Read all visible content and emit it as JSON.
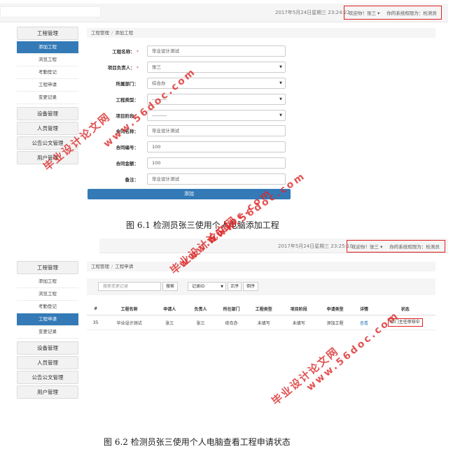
{
  "screen1": {
    "datetime": "2017年5月24日星期三 23:24:22",
    "welcome": "欢迎你！张三",
    "role": "你的系统权限为：检测员",
    "breadcrumb": [
      "工程管理",
      "添加工程"
    ],
    "sidebar": [
      {
        "label": "工程管理",
        "items": [
          "添加工程",
          "浏览工程",
          "考勤登记",
          "工程申请",
          "变更记录"
        ],
        "active": 0
      },
      {
        "label": "设备管理"
      },
      {
        "label": "人员管理"
      },
      {
        "label": "公告公文管理"
      },
      {
        "label": "用户管理"
      }
    ],
    "form": [
      {
        "label": "工程名称",
        "required": true,
        "value": "毕业设计测试",
        "select": false
      },
      {
        "label": "项目负责人",
        "required": true,
        "value": "张三",
        "select": true
      },
      {
        "label": "所属部门",
        "required": false,
        "value": "综合办",
        "select": true
      },
      {
        "label": "工程类型",
        "required": false,
        "value": "---------",
        "select": true
      },
      {
        "label": "项目阶段",
        "required": false,
        "value": "---------",
        "select": true
      },
      {
        "label": "合同名称",
        "required": false,
        "value": "毕业设计测试",
        "select": false
      },
      {
        "label": "合同编号",
        "required": false,
        "value": "100",
        "select": false
      },
      {
        "label": "合同金额",
        "required": false,
        "value": "100",
        "select": false
      },
      {
        "label": "备注",
        "required": false,
        "value": "毕业设计测试",
        "select": false
      }
    ],
    "add_button": "添加",
    "caption": "图 6.1  检测员张三使用个人电脑添加工程"
  },
  "screen2": {
    "datetime": "2017年5月24日星期三 23:25:10",
    "welcome": "欢迎你！张三",
    "role": "你的系统权限为：检测员",
    "breadcrumb": [
      "工程管理",
      "工程申请"
    ],
    "sidebar": [
      {
        "label": "工程管理",
        "items": [
          "添加工程",
          "浏览工程",
          "考勤登记",
          "工程申请",
          "变更记录"
        ],
        "active": 3
      },
      {
        "label": "设备管理"
      },
      {
        "label": "人员管理"
      },
      {
        "label": "公告公文管理"
      },
      {
        "label": "用户管理"
      }
    ],
    "search_placeholder": "搜索变更记录",
    "search_button": "搜索",
    "sort_select": "记录ID",
    "asc_button": "正序",
    "desc_button": "倒序",
    "table": {
      "headers": [
        "#",
        "工程名称",
        "申请人",
        "负责人",
        "所在部门",
        "工程类型",
        "项目阶段",
        "申请类型",
        "详情",
        "状态"
      ],
      "rows": [
        [
          "35",
          "毕业设计测试",
          "张三",
          "张三",
          "综合办",
          "未填写",
          "未填写",
          "添加工程",
          "查看",
          "部门主任审核中"
        ]
      ]
    },
    "caption": "图 6.2  检测员张三使用个人电脑查看工程申请状态"
  },
  "watermarks": {
    "site": "毕业设计论文网",
    "url": "www.56doc.com"
  },
  "colors": {
    "primary": "#337ab7",
    "highlight": "#e02020",
    "watermark": "#dc2828"
  }
}
